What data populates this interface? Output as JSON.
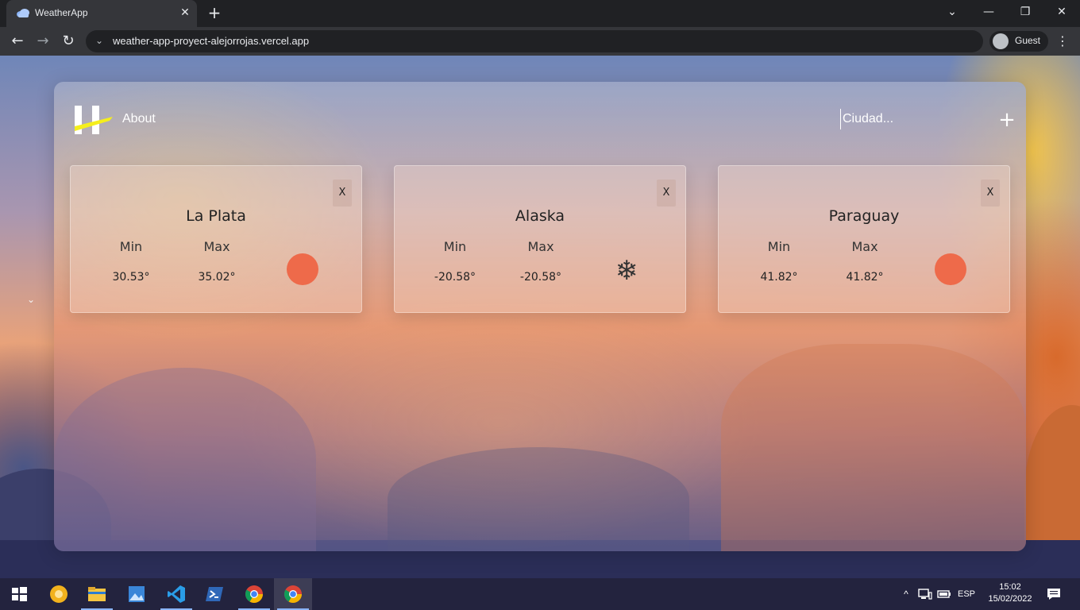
{
  "browser": {
    "tab_title": "WeatherApp",
    "url": "weather-app-proyect-alejorrojas.vercel.app",
    "profile_label": "Guest"
  },
  "app": {
    "nav_about": "About",
    "search_placeholder": "Ciudad...",
    "add_label": "+"
  },
  "cards": [
    {
      "close": "X",
      "city": "La Plata",
      "min_label": "Min",
      "max_label": "Max",
      "min": "30.53°",
      "max": "35.02°",
      "icon": "sun-icon"
    },
    {
      "close": "X",
      "city": "Alaska",
      "min_label": "Min",
      "max_label": "Max",
      "min": "-20.58°",
      "max": "-20.58°",
      "icon": "snowflake-icon"
    },
    {
      "close": "X",
      "city": "Paraguay",
      "min_label": "Min",
      "max_label": "Max",
      "min": "41.82°",
      "max": "41.82°",
      "icon": "sun-icon"
    }
  ],
  "taskbar": {
    "language": "ESP",
    "time": "15:02",
    "date": "15/02/2022"
  },
  "colors": {
    "sun": "#ee6a4a",
    "chrome_dark": "#202124",
    "chrome_toolbar": "#35363a",
    "taskbar": "#23233e"
  }
}
